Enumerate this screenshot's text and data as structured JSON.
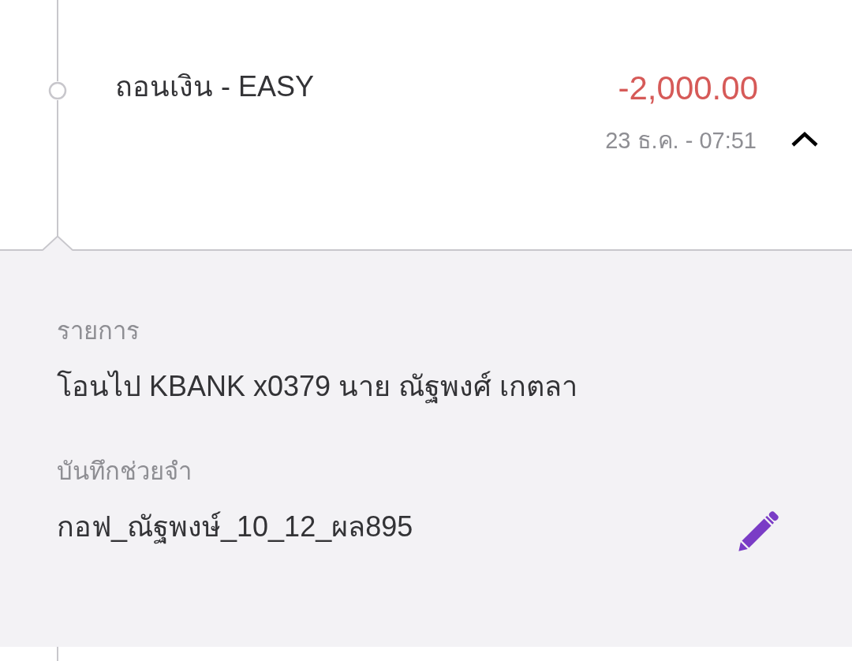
{
  "transaction": {
    "title": "ถอนเงิน - EASY",
    "amount": "-2,000.00",
    "datetime": "23 ธ.ค. - 07:51",
    "expanded": true
  },
  "details": [
    {
      "label": "รายการ",
      "value": "โอนไป KBANK x0379 นาย ณัฐพงศ์ เกตลา",
      "editable": false
    },
    {
      "label": "บันทึกช่วยจำ",
      "value": "กอฟ_ณัฐพงษ์_10_12_ผล895",
      "editable": true
    }
  ]
}
